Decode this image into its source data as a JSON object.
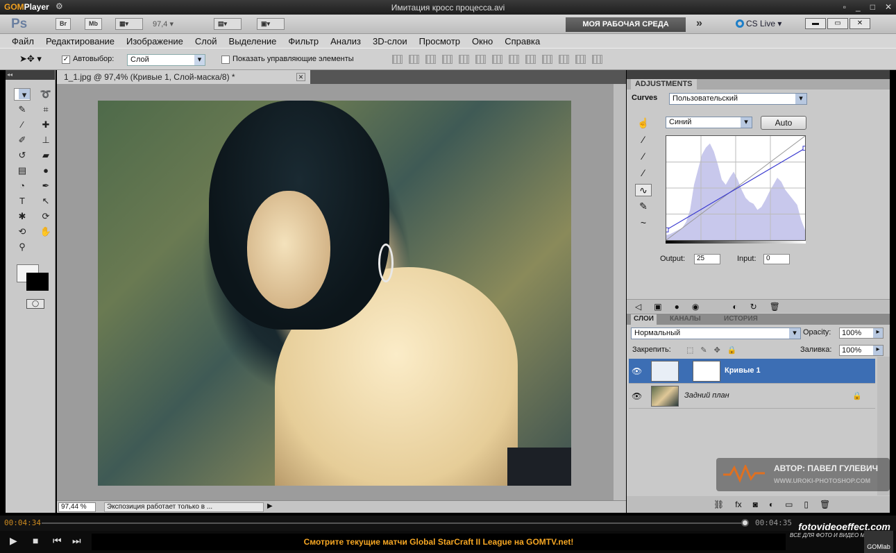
{
  "player": {
    "logo_a": "GOM",
    "logo_b": "Player",
    "file_title": "Имитация кросс процесса.avi",
    "time_elapsed": "00:04:34",
    "time_total": "00:04:35",
    "ticker": "Смотрите текущие матчи Global StarCraft II League на GOMTV.net!",
    "brand_title": "fotovideoeffect.com",
    "brand_sub": "ВСЕ ДЛЯ ФОТО И ВИДЕО МОНТАЖА!",
    "gomlab": "GOMlab"
  },
  "appbar": {
    "ps_logo": "Ps",
    "br": "Br",
    "mb": "Mb",
    "zoom": "97,4",
    "workspace": "МОЯ РАБОЧАЯ СРЕДА",
    "arrows": "»",
    "cs_live": "CS Live ▾"
  },
  "menu": [
    "Файл",
    "Редактирование",
    "Изображение",
    "Слой",
    "Выделение",
    "Фильтр",
    "Анализ",
    "3D-слои",
    "Просмотр",
    "Окно",
    "Справка"
  ],
  "options": {
    "autoselect_label": "Автовыбор:",
    "autoselect_value": "Слой",
    "show_controls_label": "Показать управляющие элементы"
  },
  "document": {
    "tab_title": "1_1.jpg @ 97,4% (Кривые 1, Слой-маска/8) *",
    "zoom": "97,44 %",
    "status": "Экспозиция работает только в ..."
  },
  "adjustments": {
    "tab": "ADJUSTMENTS",
    "title": "Curves",
    "preset": "Пользовательский",
    "channel": "Синий",
    "auto_label": "Auto",
    "output_label": "Output:",
    "output_value": "25",
    "input_label": "Input:",
    "input_value": "0",
    "curve": {
      "points": [
        [
          0,
          25
        ],
        [
          255,
          225
        ]
      ]
    }
  },
  "layers": {
    "tabs": [
      "СЛОИ",
      "КАНАЛЫ",
      "ИСТОРИЯ"
    ],
    "blend_mode": "Нормальный",
    "opacity_label": "Opacity:",
    "opacity": "100%",
    "lock_label": "Закрепить:",
    "fill_label": "Заливка:",
    "fill": "100%",
    "items": [
      {
        "name": "Кривые 1",
        "active": true
      },
      {
        "name": "Задний план",
        "active": false
      }
    ]
  },
  "watermark": {
    "author": "АВТОР: ПАВЕЛ ГУЛЕВИЧ",
    "site": "WWW.UROKI-PHOTOSHOP.COM"
  },
  "colors": {
    "accent_blue": "#3c6eb4",
    "ticker_orange": "#f5a623",
    "curve_line": "#3a3ad0"
  }
}
